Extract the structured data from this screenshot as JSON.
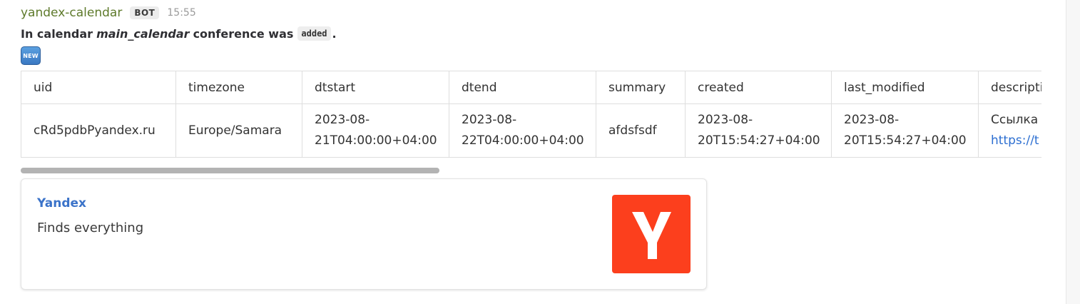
{
  "message": {
    "sender": "yandex-calendar",
    "badge": "BOT",
    "time": "15:55",
    "text_prefix": "In calendar",
    "calendar_name": "main_calendar",
    "text_middle": "conference was",
    "action_code": "added",
    "text_suffix": ".",
    "emoji_label": "NEW"
  },
  "table": {
    "headers": [
      "uid",
      "timezone",
      "dtstart",
      "dtend",
      "summary",
      "created",
      "last_modified",
      "description"
    ],
    "rows": [
      {
        "uid": "cRd5pdbPyandex.ru",
        "timezone": "Europe/Samara",
        "dtstart_1": "2023-08-",
        "dtstart_2": "21T04:00:00+04:00",
        "dtend_1": "2023-08-",
        "dtend_2": "22T04:00:00+04:00",
        "summary": "afdsfsdf",
        "created_1": "2023-08-",
        "created_2": "20T15:54:27+04:00",
        "last_modified_1": "2023-08-",
        "last_modified_2": "20T15:54:27+04:00",
        "description_1": "Ссылка",
        "description_link": "https://t"
      }
    ]
  },
  "scroll": {
    "position_fraction": 0.0,
    "visible_fraction": 0.41
  },
  "link_preview": {
    "title": "Yandex",
    "description": "Finds everything",
    "logo_icon": "yandex-logo-icon",
    "logo_color": "#fc3f1d"
  },
  "colors": {
    "sender": "#5e7a2b",
    "link": "#2d6fd1",
    "preview_title": "#3b73c9"
  }
}
